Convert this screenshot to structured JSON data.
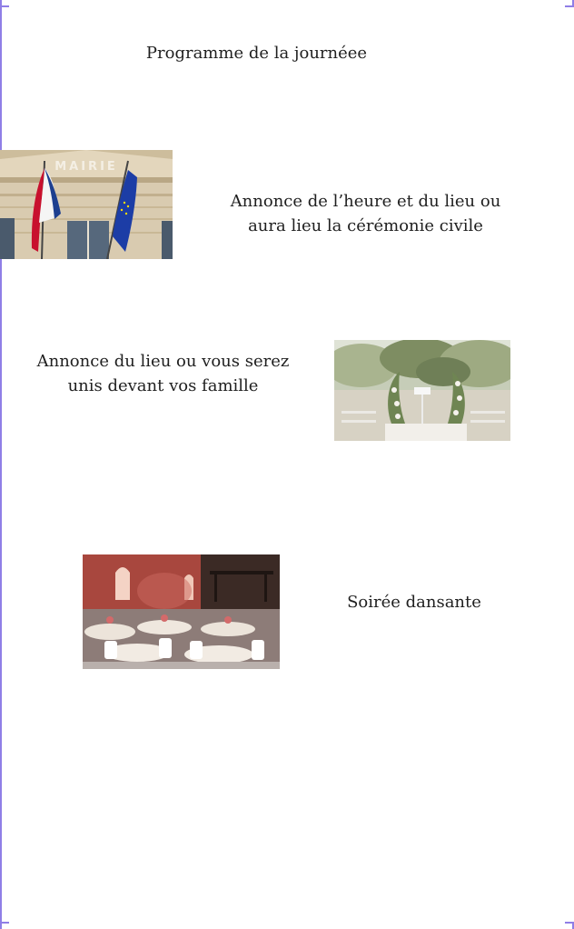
{
  "page": {
    "title": "Programme de la journéee"
  },
  "sections": [
    {
      "text": "Annonce de l’heure et du lieu ou aura lieu la cérémonie civile",
      "image": "town-hall-photo"
    },
    {
      "text": "Annonce du lieu ou vous serez unis devant vos famille",
      "image": "garden-ceremony-photo"
    },
    {
      "text": "Soirée dansante",
      "image": "reception-hall-photo"
    }
  ],
  "images": {
    "mairie_sign": "MAIRIE"
  },
  "colors": {
    "frame_accent": "#8f7ee6",
    "text": "#1f1f1f",
    "background": "#ffffff"
  }
}
